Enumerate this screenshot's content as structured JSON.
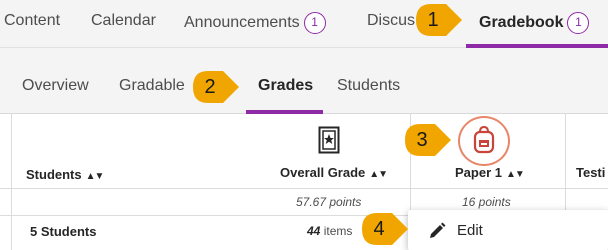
{
  "top_nav": {
    "tabs": [
      {
        "label": "Content"
      },
      {
        "label": "Calendar"
      },
      {
        "label": "Announcements",
        "badge": "1"
      },
      {
        "label": "Discus"
      },
      {
        "label": "Gradebook",
        "badge": "1",
        "active": true
      }
    ]
  },
  "sub_nav": {
    "tabs": [
      {
        "label": "Overview"
      },
      {
        "label": "Gradable"
      },
      {
        "label": "Grades",
        "active": true
      },
      {
        "label": "Students"
      }
    ]
  },
  "grid": {
    "columns": {
      "students": "Students",
      "overall_grade": "Overall Grade",
      "paper1": "Paper 1",
      "testing": "Testi"
    },
    "points_row": {
      "overall": "57.67 points",
      "paper1": "16 points"
    },
    "summary_row": {
      "students_count": "5 Students",
      "items_count": "44",
      "items_word": "items"
    }
  },
  "menu": {
    "edit_label": "Edit"
  },
  "callouts": [
    "1",
    "2",
    "3",
    "4"
  ],
  "colors": {
    "accent": "#8e2aa6",
    "callout": "#f0a500",
    "highlight_ring": "#e8866a",
    "item_icon": "#c9453b"
  },
  "icons": {
    "overall_grade": "overall-grade-icon",
    "paper1": "backpack-icon",
    "menu_edit": "pencil-icon",
    "sort": "sort-icon"
  }
}
